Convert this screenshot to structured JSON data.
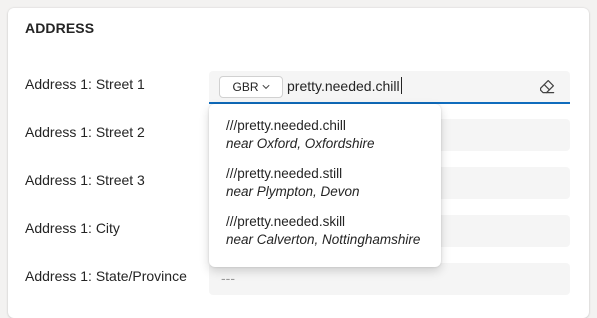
{
  "section": {
    "title": "ADDRESS"
  },
  "fields": [
    {
      "label": "Address 1: Street 1"
    },
    {
      "label": "Address 1: Street 2"
    },
    {
      "label": "Address 1: Street 3"
    },
    {
      "label": "Address 1: City"
    },
    {
      "label": "Address 1: State/Province",
      "placeholder": "---"
    }
  ],
  "street1": {
    "country_code": "GBR",
    "value": "pretty.needed.chill",
    "clear_icon": "eraser-icon"
  },
  "suggestions": [
    {
      "words": "///pretty.needed.chill",
      "near": "near Oxford, Oxfordshire"
    },
    {
      "words": "///pretty.needed.still",
      "near": "near Plympton, Devon"
    },
    {
      "words": "///pretty.needed.skill",
      "near": "near Calverton, Nottinghamshire"
    }
  ],
  "colors": {
    "accent": "#0f6cbd",
    "field_bg": "#f5f5f5",
    "text": "#242424",
    "page_bg": "#f3f2f1"
  }
}
